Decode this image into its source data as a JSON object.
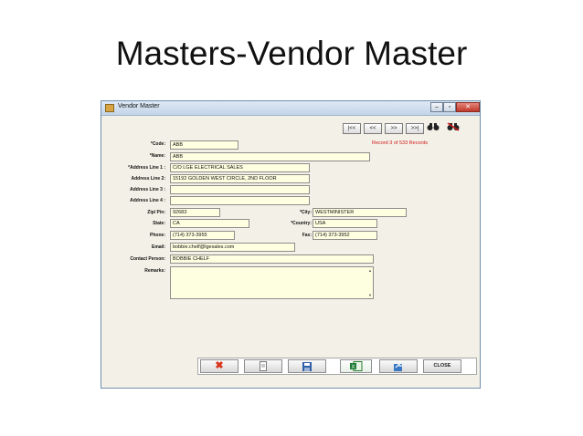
{
  "slide": {
    "title": "Masters-Vendor Master"
  },
  "window": {
    "title": "Vendor Master",
    "controls": {
      "minimize": "–",
      "maximize": "▫",
      "close": "✕"
    }
  },
  "nav": {
    "first": "|<<",
    "prev": "<<",
    "next": ">>",
    "last": ">>|",
    "record_text": "Record 3 of 533 Records"
  },
  "icons": {
    "find": "binoculars-icon",
    "find_clear": "binoculars-clear-icon",
    "delete": "delete-icon",
    "new": "new-document-icon",
    "save": "save-icon",
    "export": "excel-export-icon",
    "undo": "undo-icon"
  },
  "form": {
    "code": {
      "label": "*Code:",
      "value": "ABB"
    },
    "name": {
      "label": "*Name:",
      "value": "ABB"
    },
    "address1": {
      "label": "*Address Line 1 :",
      "value": "C/O LGE ELECTRICAL SALES"
    },
    "address2": {
      "label": "Address Line 2:",
      "value": "15192 GOLDEN WEST CIRCLE, 2ND FLOOR"
    },
    "address3": {
      "label": "Address Line 3 :",
      "value": ""
    },
    "address4": {
      "label": "Address Line 4 :",
      "value": ""
    },
    "zip": {
      "label": "Zip/ Pin:",
      "value": "92683"
    },
    "city": {
      "label": "*City:",
      "value": "WESTMINISTER"
    },
    "state": {
      "label": "State:",
      "value": "CA"
    },
    "country": {
      "label": "*Country:",
      "value": "USA"
    },
    "phone": {
      "label": "Phone:",
      "value": "(714) 373-3955"
    },
    "fax": {
      "label": "Fax:",
      "value": "(714) 373-3952"
    },
    "email": {
      "label": "Email:",
      "value": "bobbie.chelf@lgesales.com"
    },
    "contact": {
      "label": "Contact Person:",
      "value": "BOBBIE CHELF"
    },
    "remarks": {
      "label": "Remarks:",
      "value": ""
    }
  },
  "buttons": {
    "close": "CLOSE"
  },
  "colors": {
    "field_bg": "#fefee0",
    "record_text": "#d01818",
    "window_bg": "#f3f1e7"
  }
}
